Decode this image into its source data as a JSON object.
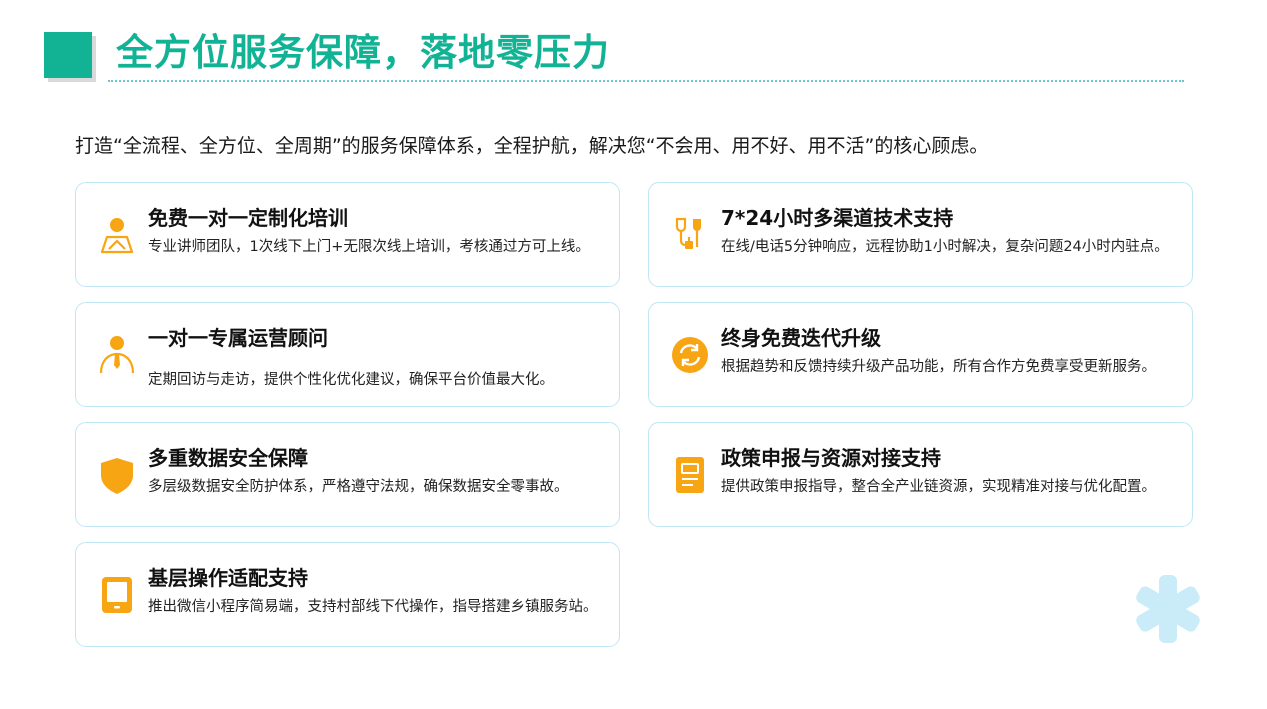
{
  "header": {
    "title": "全方位服务保障，落地零压力",
    "intro": "打造“全流程、全方位、全周期”的服务保障体系，全程护航，解决您“不会用、用不好、用不活”的核心顾虑。"
  },
  "colors": {
    "accent": "#11b394",
    "icon": "#f7a513",
    "card_border": "#bfe7f3",
    "decor": "#c9ecf8"
  },
  "cards": [
    {
      "title": "免费一对一定制化培训",
      "desc": "专业讲师团队，1次线下上门+无限次线上培训，考核通过方可上线。",
      "icon": "trainer-icon"
    },
    {
      "title": "7*24小时多渠道技术支持",
      "desc": "在线/电话5分钟响应，远程协助1小时解决，复杂问题24小时内驻点。",
      "icon": "headset-plug-icon"
    },
    {
      "title": "一对一专属运营顾问",
      "desc": "定期回访与走访，提供个性化优化建议，确保平台价值最大化。",
      "icon": "consultant-icon"
    },
    {
      "title": "终身免费迭代升级",
      "desc": "根据趋势和反馈持续升级产品功能，所有合作方免费享受更新服务。",
      "icon": "refresh-icon"
    },
    {
      "title": "多重数据安全保障",
      "desc": "多层级数据安全防护体系，严格遵守法规，确保数据安全零事故。",
      "icon": "shield-icon"
    },
    {
      "title": "政策申报与资源对接支持",
      "desc": "提供政策申报指导，整合全产业链资源，实现精准对接与优化配置。",
      "icon": "document-icon"
    },
    {
      "title": "基层操作适配支持",
      "desc": "推出微信小程序简易端，支持村部线下代操作，指导搭建乡镇服务站。",
      "icon": "tablet-icon"
    }
  ]
}
